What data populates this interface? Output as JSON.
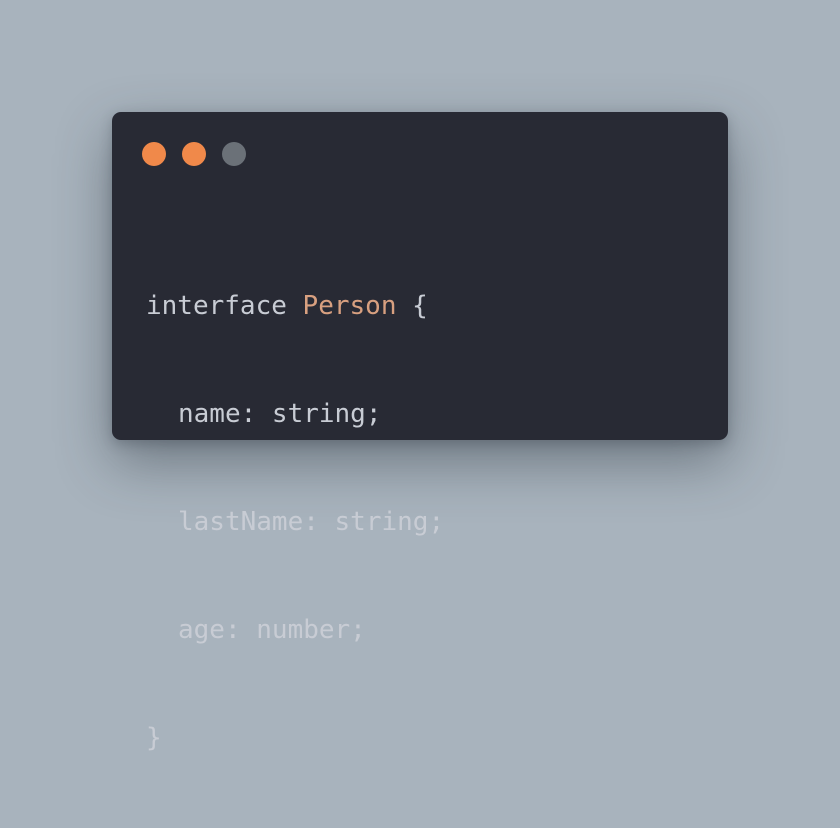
{
  "window": {
    "controls": [
      {
        "name": "close",
        "color": "#f0894a"
      },
      {
        "name": "minimize",
        "color": "#f0894a"
      },
      {
        "name": "maximize",
        "color": "#6b7178"
      }
    ]
  },
  "code": {
    "colors": {
      "keyword": "#c8ccd4",
      "type_name": "#d8a080",
      "text": "#c8ccd4"
    },
    "lines": {
      "l1_keyword": "interface",
      "l1_name": "Person",
      "l1_brace": "{",
      "l2": "name: string;",
      "l3": "lastName: string;",
      "l4": "age: number;",
      "l5": "}"
    }
  }
}
